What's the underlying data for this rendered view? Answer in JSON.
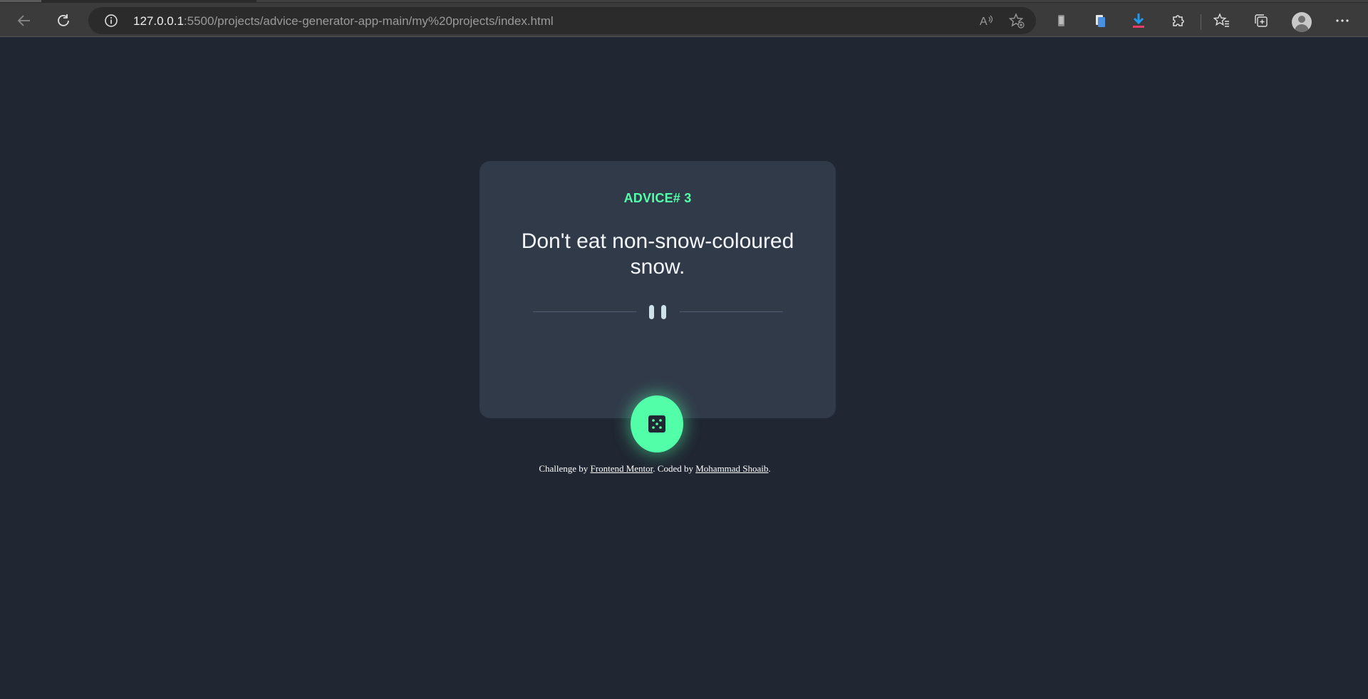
{
  "browser": {
    "url_host": "127.0.0.1",
    "url_path": ":5500/projects/advice-generator-app-main/my%20projects/index.html",
    "icons": [
      "back-icon",
      "refresh-icon",
      "info-icon",
      "read-aloud-icon",
      "add-favorite-icon",
      "phone-icon",
      "page-icon",
      "download-icon",
      "extensions-icon",
      "favorites-icon",
      "collections-icon",
      "profile-icon",
      "more-icon"
    ]
  },
  "card": {
    "advice_label": "ADVICE# 3",
    "advice_text": "Don't eat non-snow-coloured snow.",
    "dice_button_icon": "dice-icon"
  },
  "attribution": {
    "prefix": "Challenge by ",
    "link1": "Frontend Mentor",
    "middle": ". Coded by ",
    "link2": "Mohammad Shoaib",
    "suffix": "."
  },
  "colors": {
    "background": "#202632",
    "card": "#313a49",
    "accent": "#52ffa8",
    "text": "#f3f6fb"
  }
}
